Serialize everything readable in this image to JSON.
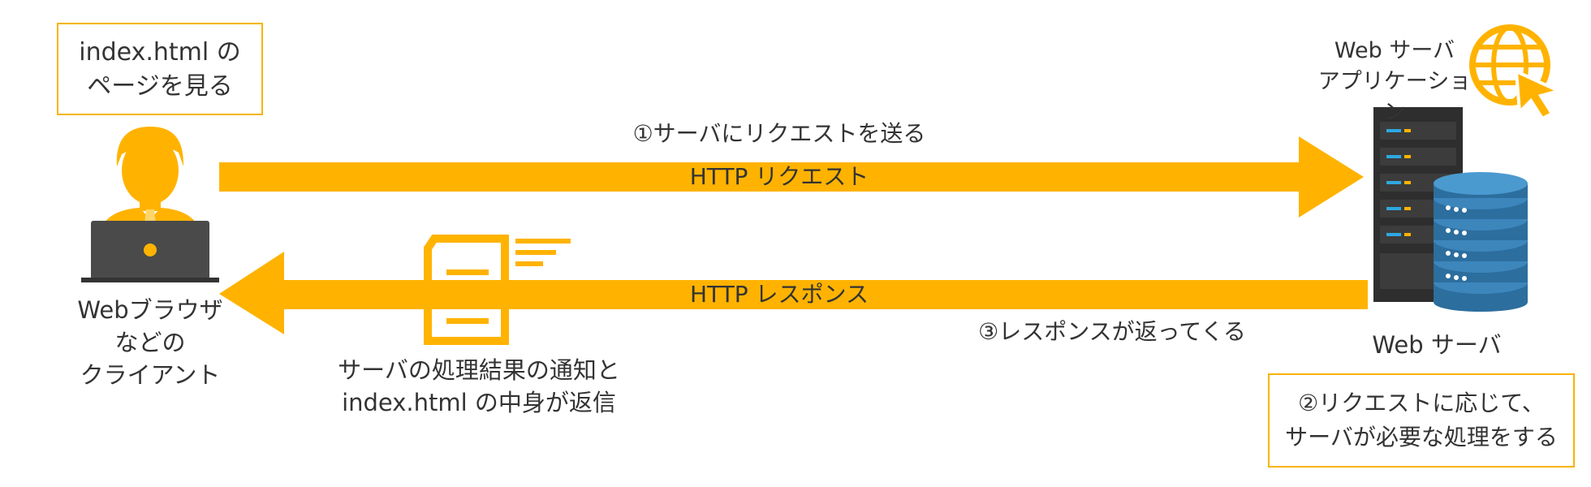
{
  "colors": {
    "accent": "#FFB300",
    "text": "#333333",
    "server_dark": "#2E2E2E",
    "db_blue": "#2C6E9E"
  },
  "client_note": {
    "lines": [
      "index.html の",
      "ページを見る"
    ]
  },
  "client_label": {
    "lines": [
      "Webブラウザ",
      "などの",
      "クライアント"
    ]
  },
  "request": {
    "caption": "①サーバにリクエストを送る",
    "arrow_text": "HTTP リクエスト"
  },
  "response": {
    "arrow_text": "HTTP レスポンス",
    "caption": "③レスポンスが返ってくる"
  },
  "document_label": {
    "lines": [
      "サーバの処理結果の通知と",
      "index.html の中身が返信"
    ]
  },
  "server_app_label": {
    "lines": [
      "Web サーバ",
      "アプリケーション"
    ]
  },
  "server_label": "Web サーバ",
  "server_note": {
    "lines": [
      "②リクエストに応じて、",
      "サーバが必要な処理をする"
    ]
  },
  "icons": [
    "user-laptop-icon",
    "document-icon",
    "globe-cursor-icon",
    "server-rack-icon",
    "database-icon"
  ]
}
